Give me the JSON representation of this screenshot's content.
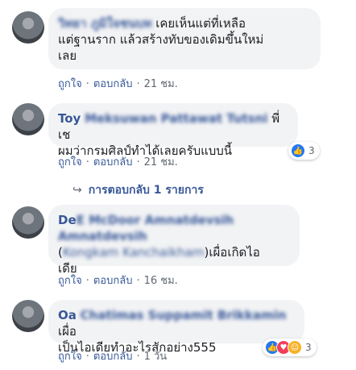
{
  "comments": [
    {
      "author": "วิทยา ภูมิใจชนบท",
      "text": "เคยเห็นแต่ที่เหลือแต่ฐานราก แล้วสร้างทับของเดิมขึ้นใหม่เลย",
      "line2": "แต่ฐานราก แล้วสร้างทับของเดิมขึ้นใหม่",
      "line3": "เลย",
      "like": "ถูกใจ",
      "reply": "ตอบกลับ",
      "time": "21 ชม."
    },
    {
      "author": "Toy",
      "author_blur": "Meksuwan Pattawat Tutsni",
      "line1_end": "พี่เช",
      "line2": "ผมว่ากรมศิลป์ทำได้เลยครับแบบนี้",
      "like": "ถูกใจ",
      "reply": "ตอบกลับ",
      "time": "21 ชม.",
      "reaction_count": "3",
      "reaction_icons": [
        "like-icon"
      ]
    },
    {
      "author": "De",
      "author_blur": "E McDoor Amnatdevsih Amnatdevsih",
      "line2_mention": "Kongkam Kanchaikham",
      "line2_end": "เผื่อเกิดไอ",
      "line3": "เดีย",
      "like": "ถูกใจ",
      "reply": "ตอบกลับ",
      "time": "16 ชม."
    },
    {
      "author": "Oa",
      "author_blur": "Chatimas Suppamit Brikkamin",
      "line1_end": "เผื่อ",
      "line2": "เป็นไอเดียทำอะไรสักอย่าง555",
      "like": "ถูกใจ",
      "reply": "ตอบกลับ",
      "time": "1 วัน",
      "reaction_count": "3",
      "reaction_icons": [
        "like-icon",
        "love-icon",
        "haha-icon"
      ]
    }
  ],
  "replies_link": "การตอบกลับ 1 รายการ",
  "colors": {
    "link": "#385898",
    "bubble": "#f2f3f5",
    "meta": "#606770"
  }
}
